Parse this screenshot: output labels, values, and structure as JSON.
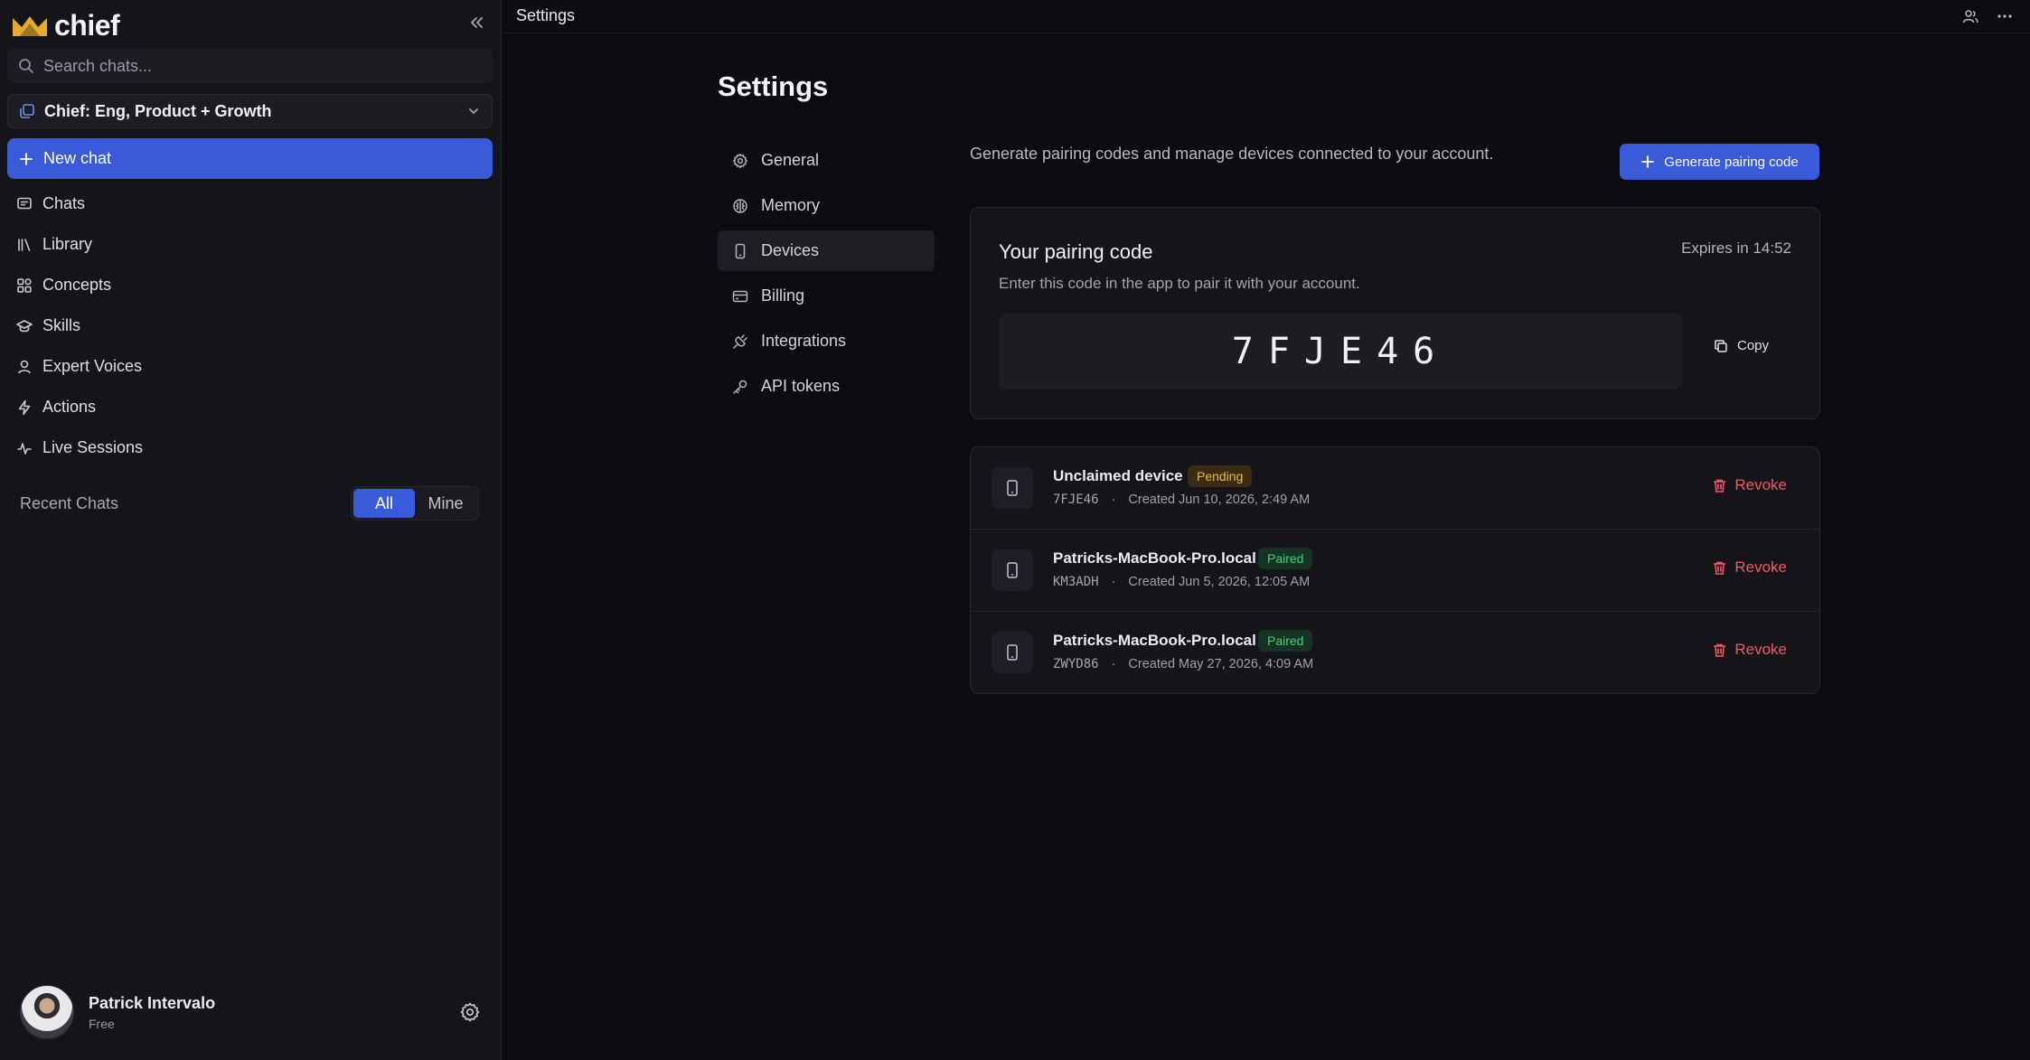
{
  "app": {
    "name": "chief"
  },
  "sidebar": {
    "search_placeholder": "Search chats...",
    "workspace": "Chief: Eng, Product + Growth",
    "new_chat": "New chat",
    "nav": [
      {
        "label": "Chats",
        "icon": "chat-icon"
      },
      {
        "label": "Library",
        "icon": "library-icon"
      },
      {
        "label": "Concepts",
        "icon": "concepts-icon"
      },
      {
        "label": "Skills",
        "icon": "graduation-cap-icon"
      },
      {
        "label": "Expert Voices",
        "icon": "person-icon"
      },
      {
        "label": "Actions",
        "icon": "bolt-icon"
      },
      {
        "label": "Live Sessions",
        "icon": "activity-icon"
      }
    ],
    "recent_title": "Recent Chats",
    "recent_filter": {
      "options": [
        "All",
        "Mine"
      ],
      "selected": "All"
    },
    "user": {
      "name": "Patrick Intervalo",
      "plan": "Free"
    }
  },
  "topbar": {
    "breadcrumb": "Settings"
  },
  "settings": {
    "title": "Settings",
    "nav": [
      {
        "label": "General",
        "icon": "gear-icon"
      },
      {
        "label": "Memory",
        "icon": "brain-icon"
      },
      {
        "label": "Devices",
        "icon": "phone-icon"
      },
      {
        "label": "Billing",
        "icon": "card-icon"
      },
      {
        "label": "Integrations",
        "icon": "plug-icon"
      },
      {
        "label": "API tokens",
        "icon": "key-icon"
      }
    ],
    "active_nav": "Devices",
    "devices": {
      "description": "Generate pairing codes and manage devices connected to your account.",
      "generate_button": "Generate pairing code",
      "pairing": {
        "title": "Your pairing code",
        "subtitle": "Enter this code in the app to pair it with your account.",
        "expires": "Expires in 14:52",
        "code": "7FJE46",
        "copy_label": "Copy"
      },
      "list": [
        {
          "name": "Unclaimed device",
          "status": "Pending",
          "code": "7FJE46",
          "sep": "·",
          "created": "Created Jun 10, 2026, 2:49 AM",
          "action": "Revoke"
        },
        {
          "name": "Patricks-MacBook-Pro.local",
          "status": "Paired",
          "code": "KM3ADH",
          "sep": "·",
          "created": "Created Jun 5, 2026, 12:05 AM",
          "action": "Revoke"
        },
        {
          "name": "Patricks-MacBook-Pro.local",
          "status": "Paired",
          "code": "ZWYD86",
          "sep": "·",
          "created": "Created May 27, 2026, 4:09 AM",
          "action": "Revoke"
        }
      ]
    }
  },
  "colors": {
    "accent": "#3a5bd9",
    "danger": "#f0596a",
    "pending": "#f3b63d",
    "paired": "#4ad07c",
    "logo": "#e8a92c"
  }
}
